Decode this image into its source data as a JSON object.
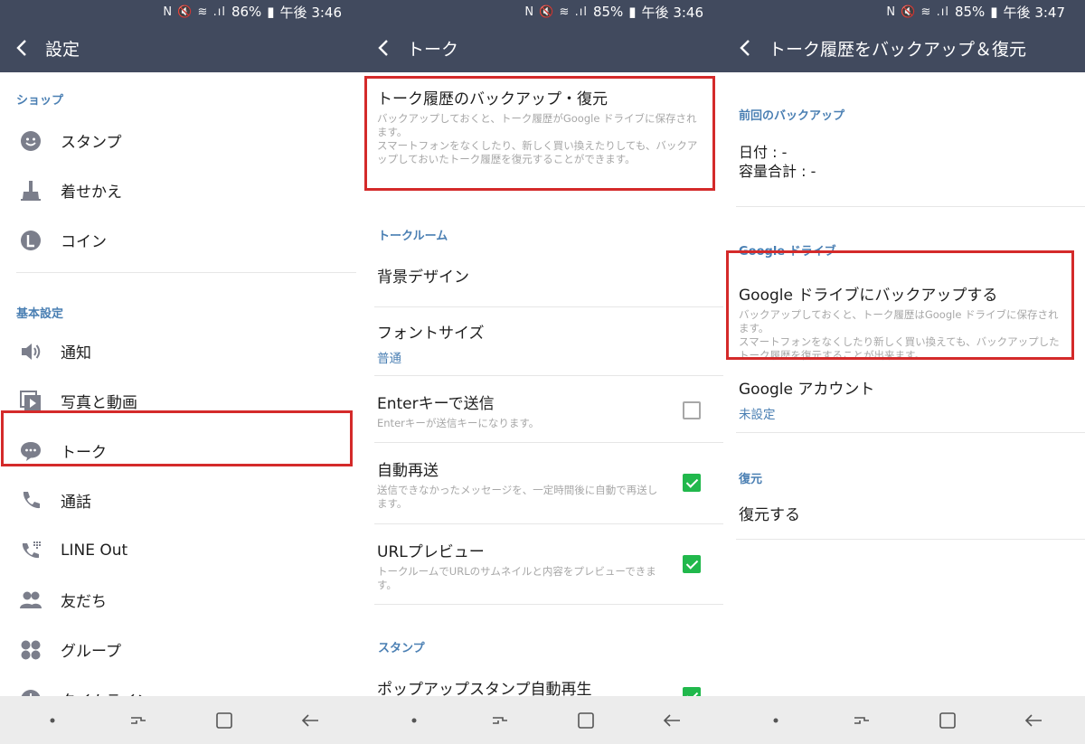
{
  "panels": [
    {
      "status": {
        "icons": "N 🔇 ≋ .ıl",
        "battery": "86%",
        "time": "午後 3:46"
      },
      "appbar_title": "設定",
      "sections": [
        {
          "label": "ショップ",
          "items": [
            "スタンプ",
            "着せかえ",
            "コイン"
          ]
        },
        {
          "label": "基本設定",
          "items": [
            "通知",
            "写真と動画",
            "トーク",
            "通話",
            "LINE Out",
            "友だち",
            "グループ",
            "タイムライン"
          ]
        }
      ],
      "icons": [
        "smiley-icon",
        "paintbrush-icon",
        "coin-icon",
        "speaker-icon",
        "photo-video-icon",
        "chat-bubble-icon",
        "phone-icon",
        "line-out-icon",
        "friends-icon",
        "group-icon",
        "clock-icon"
      ]
    },
    {
      "status": {
        "icons": "N 🔇 ≋ .ıl",
        "battery": "85%",
        "time": "午後 3:46"
      },
      "appbar_title": "トーク",
      "backup": {
        "title": "トーク履歴のバックアップ・復元",
        "desc": "バックアップしておくと、トーク履歴がGoogle ドライブに保存されます。\nスマートフォンをなくしたり、新しく買い換えたりしても、バックアップしておいたトーク履歴を復元することができます。"
      },
      "talkroom_section": "トークルーム",
      "bg_design": "背景デザイン",
      "font_size": {
        "title": "フォントサイズ",
        "value": "普通"
      },
      "enter_send": {
        "title": "Enterキーで送信",
        "desc": "Enterキーが送信キーになります。",
        "checked": false
      },
      "auto_resend": {
        "title": "自動再送",
        "desc": "送信できなかったメッセージを、一定時間後に自動で再送します。",
        "checked": true
      },
      "url_preview": {
        "title": "URLプレビュー",
        "desc": "トークルームでURLのサムネイルと内容をプレビューできます。",
        "checked": true
      },
      "stamp_section": "スタンプ",
      "popup_stamp": {
        "title": "ポップアップスタンプ自動再生",
        "checked": true
      }
    },
    {
      "status": {
        "icons": "N 🔇 ≋ .ıl",
        "battery": "85%",
        "time": "午後 3:47"
      },
      "appbar_title": "トーク履歴をバックアップ＆復元",
      "last_backup_section": "前回のバックアップ",
      "date_line": "日付 : -",
      "total_line": "容量合計 : -",
      "gdrive_section": "Google ドライブ",
      "gdrive_backup": {
        "title": "Google ドライブにバックアップする",
        "desc": "バックアップしておくと、トーク履歴はGoogle ドライブに保存されます。\nスマートフォンをなくしたり新しく買い換えても、バックアップしたトーク履歴を復元することが出来ます。"
      },
      "gaccount": {
        "title": "Google アカウント",
        "value": "未設定"
      },
      "restore_section": "復元",
      "restore": "復元する"
    }
  ],
  "colors": {
    "header": "#414a5e",
    "accent_blue": "#4a7fb3",
    "highlight_red": "#d42a2a",
    "check_green": "#21b84c"
  }
}
